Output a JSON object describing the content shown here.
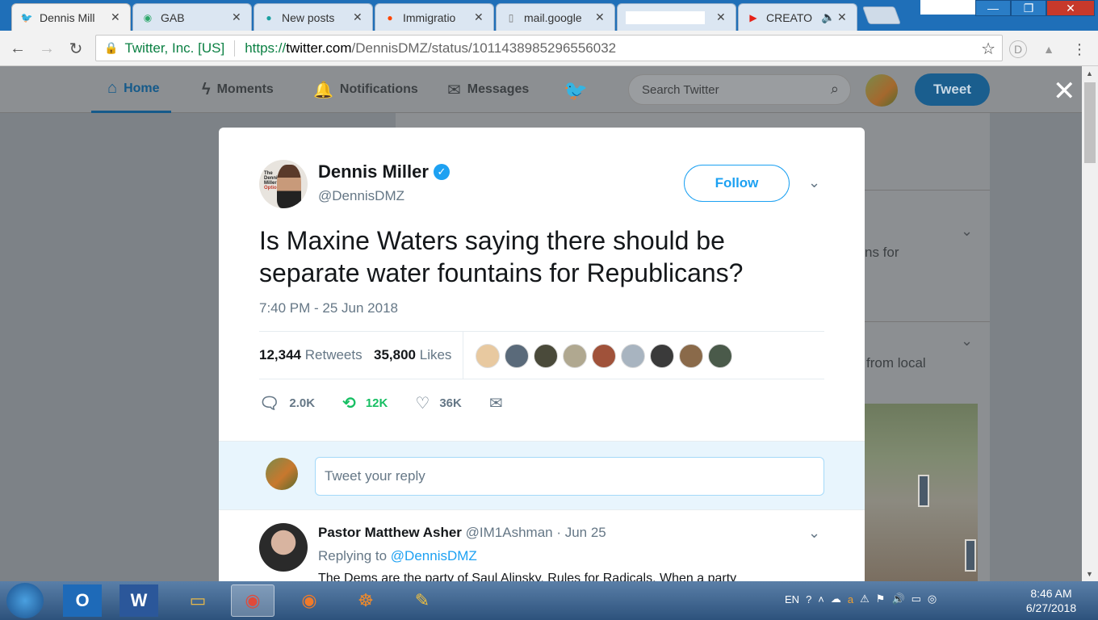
{
  "browser": {
    "tabs": [
      {
        "label": "Dennis Mill",
        "icon": "twitter-bird-icon",
        "active": true
      },
      {
        "label": "GAB",
        "icon": "gab-frog-icon",
        "active": false
      },
      {
        "label": "New posts",
        "icon": "chat-bubble-icon",
        "active": false
      },
      {
        "label": "Immigratio",
        "icon": "reddit-icon",
        "active": false
      },
      {
        "label": "mail.google",
        "icon": "page-icon",
        "active": false
      },
      {
        "label": "",
        "icon": "",
        "active": false
      },
      {
        "label": "CREATO",
        "icon": "youtube-icon",
        "active": false
      }
    ],
    "window_buttons": {
      "minimize": "—",
      "maximize": "❐",
      "close": "✕"
    },
    "site_identity": "Twitter, Inc. [US]",
    "url_proto": "https://",
    "url_host": "twitter.com",
    "url_path": "/DennisDMZ/status/1011438985296556032"
  },
  "twitter_nav": {
    "home": "Home",
    "moments": "Moments",
    "notifications": "Notifications",
    "messages": "Messages",
    "search_placeholder": "Search Twitter",
    "tweet_button": "Tweet"
  },
  "background": {
    "card1_text": "ns for",
    "card2_text": "from local"
  },
  "tweet": {
    "author_name": "Dennis Miller",
    "author_handle": "@DennisDMZ",
    "avatar_brand_lines": [
      "The",
      "Dennis",
      "Miller"
    ],
    "avatar_brand_last": "Option",
    "follow_label": "Follow",
    "text": "Is Maxine Waters saying there should be separate water fountains for Republicans?",
    "timestamp": "7:40 PM - 25 Jun 2018",
    "retweets_count": "12,344",
    "retweets_label": "Retweets",
    "likes_count": "35,800",
    "likes_label": "Likes",
    "liker_colors": [
      "#e8c9a0",
      "#5a6a7a",
      "#4a4a3a",
      "#b0a890",
      "#a0523a",
      "#a8b4c0",
      "#3a3a3a",
      "#8a6a4a",
      "#4a5a4a"
    ],
    "replies_short": "2.0K",
    "retweets_short": "12K",
    "likes_short": "36K",
    "reply_placeholder": "Tweet your reply"
  },
  "reply": {
    "name": "Pastor Matthew Asher",
    "handle_date": "@IM1Ashman · Jun 25",
    "replying_prefix": "Replying to",
    "replying_to": "@DennisDMZ",
    "text": "The Dems are the party of Saul Alinsky, Rules for Radicals.  When a party"
  },
  "taskbar": {
    "language": "EN",
    "time": "8:46 AM",
    "date": "6/27/2018"
  },
  "colors": {
    "twitter_blue": "#1da1f2",
    "retweet_green": "#17bf63",
    "text_dark": "#14171a",
    "text_muted": "#657786"
  }
}
